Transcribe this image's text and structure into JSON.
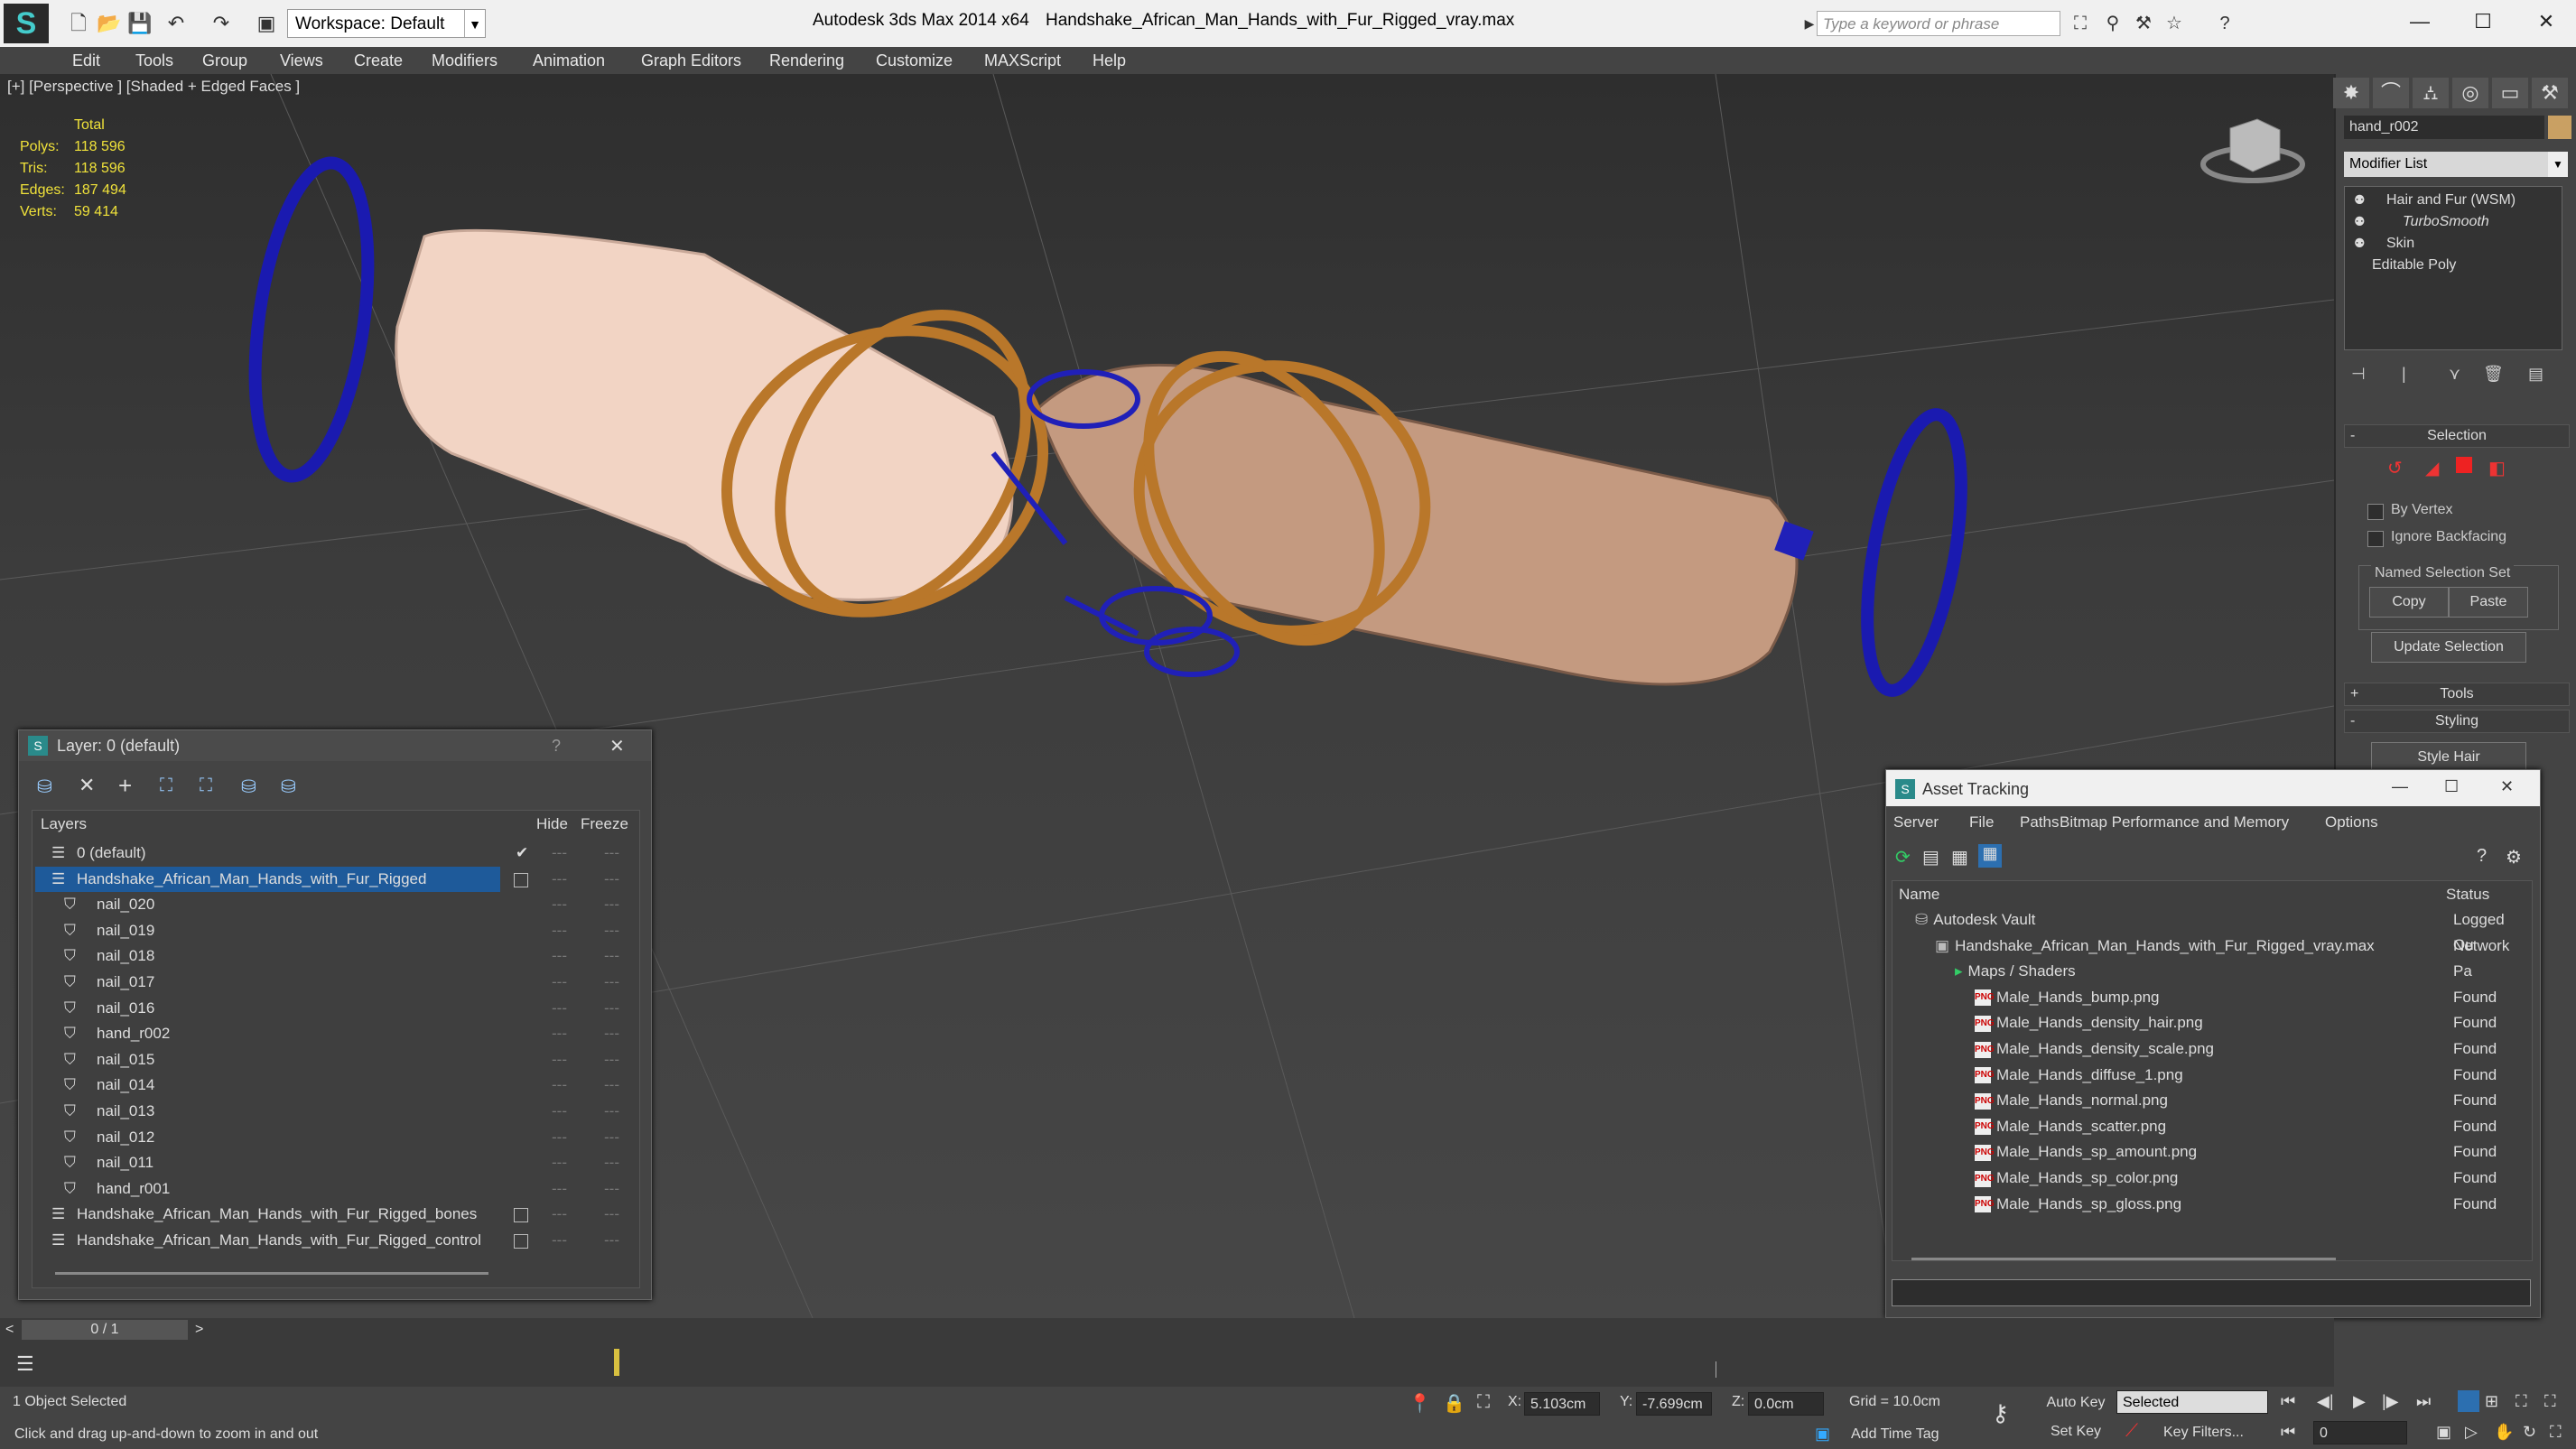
{
  "titlebar": {
    "workspace": "Workspace: Default",
    "app": "Autodesk 3ds Max  2014 x64",
    "file": "Handshake_African_Man_Hands_with_Fur_Rigged_vray.max",
    "search_placeholder": "Type a keyword or phrase"
  },
  "menu": [
    "Edit",
    "Tools",
    "Group",
    "Views",
    "Create",
    "Modifiers",
    "Animation",
    "Graph Editors",
    "Rendering",
    "Customize",
    "MAXScript",
    "Help"
  ],
  "viewport": {
    "label": "[+] [Perspective ] [Shaded + Edged Faces ]",
    "stats": {
      "header": "Total",
      "rows": [
        {
          "k": "Polys:",
          "v": "118 596"
        },
        {
          "k": "Tris:",
          "v": "118 596"
        },
        {
          "k": "Edges:",
          "v": "187 494"
        },
        {
          "k": "Verts:",
          "v": "59 414"
        }
      ]
    }
  },
  "right_panel": {
    "object_name": "hand_r002",
    "modifier_list": "Modifier List",
    "stack": [
      "Hair and Fur (WSM)",
      "TurboSmooth",
      "Skin",
      "Editable Poly"
    ],
    "selection": {
      "title": "Selection",
      "by_vertex": "By Vertex",
      "ignore_backfacing": "Ignore Backfacing",
      "named_set": "Named Selection Set",
      "copy": "Copy",
      "paste": "Paste",
      "update": "Update Selection"
    },
    "tools": "Tools",
    "styling": "Styling",
    "style_hair": "Style Hair"
  },
  "layer_dialog": {
    "title": "Layer: 0 (default)",
    "help": "?",
    "col_layers": "Layers",
    "col_hide": "Hide",
    "col_freeze": "Freeze",
    "rows": [
      {
        "name": "0 (default)",
        "level": 0,
        "check": true
      },
      {
        "name": "Handshake_African_Man_Hands_with_Fur_Rigged",
        "level": 0,
        "selected": true
      },
      {
        "name": "nail_020",
        "level": 1
      },
      {
        "name": "nail_019",
        "level": 1
      },
      {
        "name": "nail_018",
        "level": 1
      },
      {
        "name": "nail_017",
        "level": 1
      },
      {
        "name": "nail_016",
        "level": 1
      },
      {
        "name": "hand_r002",
        "level": 1
      },
      {
        "name": "nail_015",
        "level": 1
      },
      {
        "name": "nail_014",
        "level": 1
      },
      {
        "name": "nail_013",
        "level": 1
      },
      {
        "name": "nail_012",
        "level": 1
      },
      {
        "name": "nail_011",
        "level": 1
      },
      {
        "name": "hand_r001",
        "level": 1
      },
      {
        "name": "Handshake_African_Man_Hands_with_Fur_Rigged_bones",
        "level": 0
      },
      {
        "name": "Handshake_African_Man_Hands_with_Fur_Rigged_control",
        "level": 0
      }
    ]
  },
  "asset_dialog": {
    "title": "Asset Tracking",
    "menu": [
      "Server",
      "File",
      "Paths",
      "Bitmap Performance and Memory",
      "Options"
    ],
    "col_name": "Name",
    "col_status": "Status",
    "rows": [
      {
        "name": "Autodesk Vault",
        "status": "Logged Ou",
        "indent": 1,
        "icon": "vault"
      },
      {
        "name": "Handshake_African_Man_Hands_with_Fur_Rigged_vray.max",
        "status": "Network Pa",
        "indent": 2,
        "icon": "max"
      },
      {
        "name": "Maps / Shaders",
        "status": "",
        "indent": 3,
        "icon": "folder"
      },
      {
        "name": "Male_Hands_bump.png",
        "status": "Found",
        "indent": 4,
        "icon": "png"
      },
      {
        "name": "Male_Hands_density_hair.png",
        "status": "Found",
        "indent": 4,
        "icon": "png"
      },
      {
        "name": "Male_Hands_density_scale.png",
        "status": "Found",
        "indent": 4,
        "icon": "png"
      },
      {
        "name": "Male_Hands_diffuse_1.png",
        "status": "Found",
        "indent": 4,
        "icon": "png"
      },
      {
        "name": "Male_Hands_normal.png",
        "status": "Found",
        "indent": 4,
        "icon": "png"
      },
      {
        "name": "Male_Hands_scatter.png",
        "status": "Found",
        "indent": 4,
        "icon": "png"
      },
      {
        "name": "Male_Hands_sp_amount.png",
        "status": "Found",
        "indent": 4,
        "icon": "png"
      },
      {
        "name": "Male_Hands_sp_color.png",
        "status": "Found",
        "indent": 4,
        "icon": "png"
      },
      {
        "name": "Male_Hands_sp_gloss.png",
        "status": "Found",
        "indent": 4,
        "icon": "png"
      }
    ]
  },
  "timeline": {
    "frame": "0 / 1"
  },
  "status": {
    "selected": "1 Object Selected",
    "prompt": "Click and drag up-and-down to zoom in and out",
    "x_label": "X:",
    "x": "5.103cm",
    "y_label": "Y:",
    "y": "-7.699cm",
    "z_label": "Z:",
    "z": "0.0cm",
    "grid": "Grid = 10.0cm",
    "add_time_tag": "Add Time Tag",
    "auto_key": "Auto Key",
    "set_key": "Set Key",
    "selected_mode": "Selected",
    "key_filters": "Key Filters...",
    "frame_value": "0"
  }
}
